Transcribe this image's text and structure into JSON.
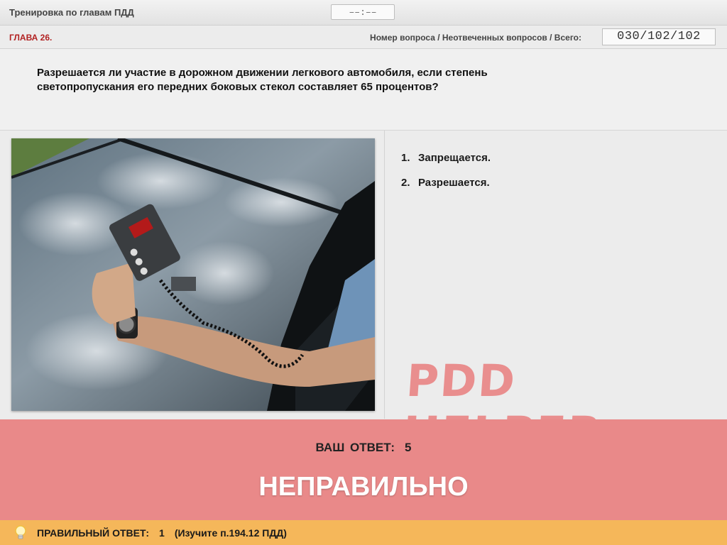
{
  "header": {
    "title": "Тренировка по главам ПДД",
    "timer": "––:––"
  },
  "subheader": {
    "chapter": "ГЛАВА 26.",
    "counter_label": "Номер вопроса / Неотвеченных вопросов / Всего:",
    "counter_value": "030/102/102"
  },
  "question": {
    "text": "Разрешается ли участие в дорожном движении легкового автомобиля, если степень светопропускания его передних боковых стекол составляет 65 процентов?"
  },
  "answers": [
    {
      "num": "1.",
      "label": "Запрещается."
    },
    {
      "num": "2.",
      "label": "Разрешается."
    }
  ],
  "watermark": "PDD HELPER",
  "result": {
    "your_answer_label": "ВАШ ОТВЕТ:",
    "your_answer_value": "5",
    "verdict": "НЕПРАВИЛЬНО"
  },
  "footer": {
    "correct_label": "ПРАВИЛЬНЫЙ ОТВЕТ:",
    "correct_value": "1",
    "hint": "(Изучите п.194.12 ПДД)"
  },
  "colors": {
    "result_bg": "#e98989",
    "footer_bg": "#f5b75a",
    "chapter_red": "#b22222",
    "watermark": "#e98e8e"
  },
  "icons": [
    "lightbulb-icon"
  ]
}
